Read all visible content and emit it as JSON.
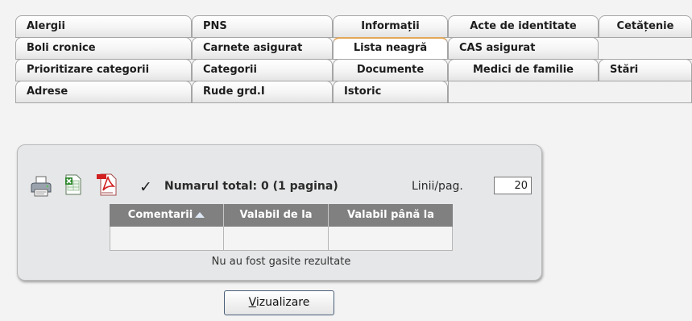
{
  "tabs": {
    "row1": [
      {
        "label": "Alergii"
      },
      {
        "label": "PNS"
      },
      {
        "label": "Informații"
      },
      {
        "label": "Acte de identitate"
      },
      {
        "label": "Cetățenie"
      }
    ],
    "row2": [
      {
        "label": "Boli cronice"
      },
      {
        "label": "Carnete asigurat"
      },
      {
        "label": "Lista neagră",
        "active": true
      },
      {
        "label": "CAS asigurat"
      }
    ],
    "row3": [
      {
        "label": "Prioritizare categorii"
      },
      {
        "label": "Categorii"
      },
      {
        "label": "Documente"
      },
      {
        "label": "Medici de familie"
      },
      {
        "label": "Stări"
      }
    ],
    "row4": [
      {
        "label": "Adrese"
      },
      {
        "label": "Rude grd.I"
      },
      {
        "label": "Istoric"
      }
    ]
  },
  "toolbar": {
    "icons": [
      "printer-icon",
      "excel-icon",
      "pdf-icon",
      "checkmark-icon"
    ],
    "check_glyph": "✓",
    "total_text": "Numarul total: 0 (1 pagina)",
    "lines_label": "Linii/pag.",
    "lines_value": "20"
  },
  "table": {
    "columns": [
      "Comentarii",
      "Valabil de la",
      "Valabil până la"
    ],
    "sorted_column": "Comentarii",
    "empty_message": "Nu au fost gasite rezultate"
  },
  "actions": {
    "view_button_underlined": "V",
    "view_button_rest": "izualizare"
  },
  "colors": {
    "active_tab_accent": "#e3a85a",
    "grid_header": "#808080",
    "panel_bg": "#e6e7e8"
  }
}
